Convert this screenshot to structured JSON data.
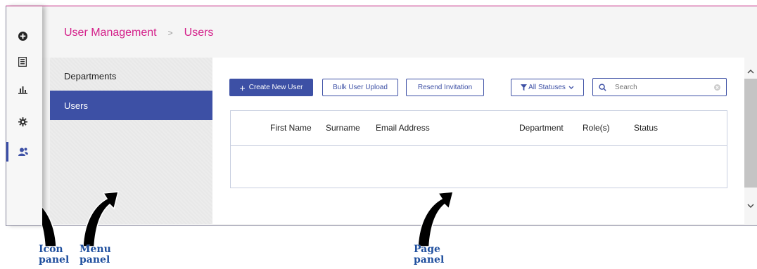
{
  "icons": {
    "add": "plus-circle-icon",
    "report": "report-icon",
    "chart": "bar-chart-icon",
    "settings": "gear-icon",
    "users": "users-icon"
  },
  "header": {
    "breadcrumb_root": "User Management",
    "breadcrumb_sep": ">",
    "breadcrumb_current": "Users"
  },
  "menu": {
    "items": [
      {
        "label": "Departments"
      },
      {
        "label": "Users"
      }
    ]
  },
  "toolbar": {
    "create_label": "Create New User",
    "bulk_label": "Bulk User Upload",
    "resend_label": "Resend Invitation",
    "status_filter": "All Statuses",
    "search_placeholder": "Search"
  },
  "table": {
    "columns": [
      "First Name",
      "Surname",
      "Email Address",
      "Department",
      "Role(s)",
      "Status"
    ]
  },
  "annotations": {
    "icon_panel_1": "Icon",
    "icon_panel_2": "panel",
    "menu_panel_1": "Menu",
    "menu_panel_2": "panel",
    "page_panel_1": "Page",
    "page_panel_2": "panel"
  },
  "colors": {
    "accent": "#3d50a5",
    "breadcrumb": "#d4208a",
    "annotation": "#1f4f9e"
  }
}
